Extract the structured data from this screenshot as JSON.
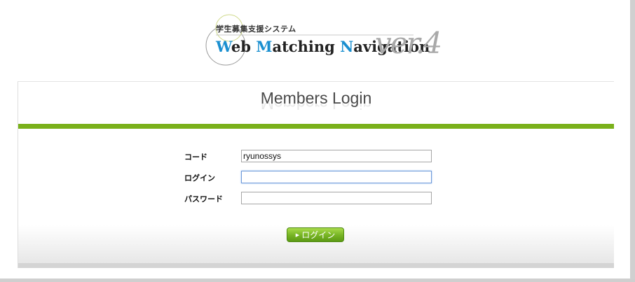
{
  "logo": {
    "subtitle": "学生募集支援システム",
    "title_parts": [
      {
        "text": "W",
        "accent": true
      },
      {
        "text": "eb ",
        "accent": false
      },
      {
        "text": "M",
        "accent": true
      },
      {
        "text": "atching ",
        "accent": false
      },
      {
        "text": "N",
        "accent": true
      },
      {
        "text": "avigation",
        "accent": false
      }
    ],
    "version": "ver.4"
  },
  "panel": {
    "title": "Members Login"
  },
  "form": {
    "code_label": "コード",
    "code_value": "ryunossys",
    "login_label": "ログイン",
    "login_value": "",
    "password_label": "パスワード",
    "password_value": ""
  },
  "submit_label": "ログイン",
  "colors": {
    "accent_blue": "#1a8fd0",
    "green_bar": "#7ab11b",
    "button_green": "#76b323"
  }
}
